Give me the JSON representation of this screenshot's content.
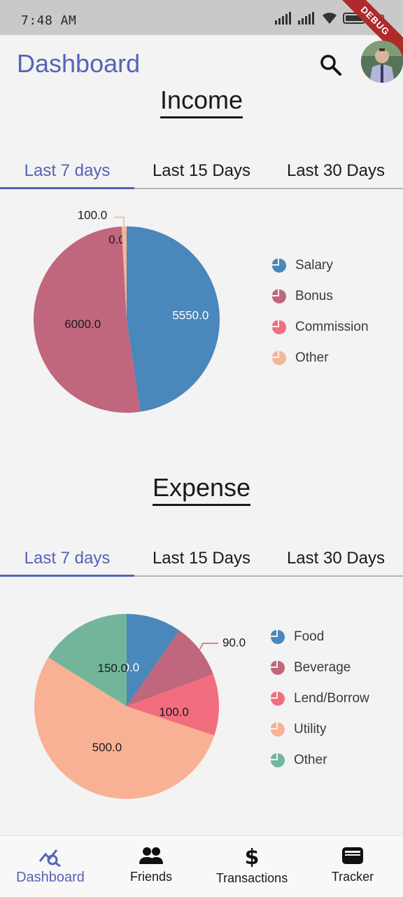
{
  "status_bar": {
    "time": "7:48 AM",
    "battery": "98",
    "debug_label": "DEBUG"
  },
  "app_bar": {
    "title": "Dashboard"
  },
  "income": {
    "title": "Income",
    "tabs": [
      "Last 7 days",
      "Last 15 Days",
      "Last 30 Days"
    ],
    "active_tab": 0,
    "chart_data": {
      "type": "pie",
      "categories": [
        "Salary",
        "Bonus",
        "Commission",
        "Other"
      ],
      "values": [
        5550.0,
        6000.0,
        0.0,
        100.0
      ],
      "labels": [
        "5550.0",
        "6000.0",
        "0.0",
        "100.0"
      ],
      "colors": [
        "#4a87bb",
        "#c0667d",
        "#f26e7e",
        "#f5b597"
      ],
      "legend": "right"
    }
  },
  "expense": {
    "title": "Expense",
    "tabs": [
      "Last 7 days",
      "Last 15 Days",
      "Last 30 Days"
    ],
    "active_tab": 0,
    "chart_data": {
      "type": "pie",
      "categories": [
        "Food",
        "Beverage",
        "Lend/Borrow",
        "Utility",
        "Other"
      ],
      "values": [
        90.0,
        90.0,
        100.0,
        500.0,
        150.0
      ],
      "labels": [
        "90.0",
        "90.0",
        "100.0",
        "500.0",
        "150.0"
      ],
      "colors": [
        "#4a87bb",
        "#c0667d",
        "#f26e7e",
        "#f8b195",
        "#73b59b"
      ],
      "legend": "right"
    }
  },
  "bottom_nav": {
    "items": [
      {
        "label": "Dashboard",
        "icon": "analytics-icon"
      },
      {
        "label": "Friends",
        "icon": "people-icon"
      },
      {
        "label": "Transactions",
        "icon": "dollar-icon"
      },
      {
        "label": "Tracker",
        "icon": "wallet-icon"
      }
    ],
    "active": 0
  }
}
